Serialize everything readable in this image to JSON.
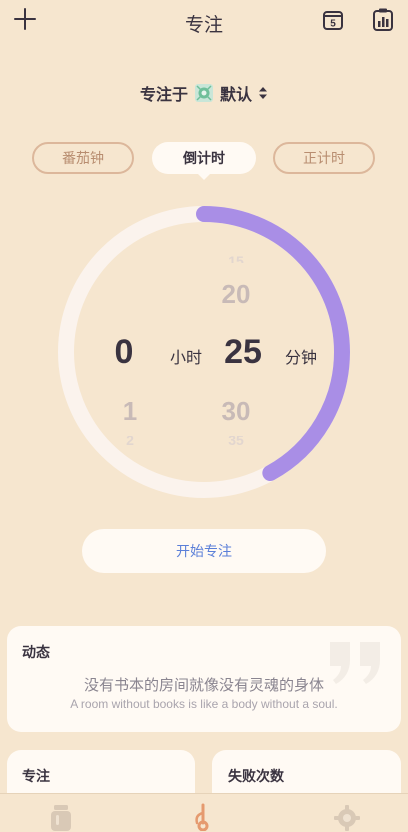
{
  "header": {
    "title": "专注",
    "calendar_day": "5"
  },
  "focus_target": {
    "prefix": "专注于",
    "name": "默认"
  },
  "modes": {
    "pomodoro": "番茄钟",
    "countdown": "倒计时",
    "countup": "正计时"
  },
  "timer": {
    "hours": "0",
    "hours_unit": "小时",
    "minutes": "25",
    "minutes_unit": "分钟",
    "hour_wheel_below": "1",
    "minute_wheel_above": "20",
    "minute_wheel_below": "30",
    "progress_fraction": 0.42
  },
  "start_button": "开始专注",
  "activity": {
    "title": "动态",
    "quote_zh": "没有书本的房间就像没有灵魂的身体",
    "quote_en": "A room without books is like a body without a soul."
  },
  "stats": {
    "focus_label": "专注",
    "fail_label": "失败次数"
  },
  "colors": {
    "background": "#f6e6cf",
    "progress": "#a98ee6",
    "track": "#fbf3ed",
    "accent_blue": "#5b7fd8",
    "tab_border": "#dcb79b"
  },
  "icons": [
    "plus-icon",
    "calendar-icon",
    "clipboard-chart-icon",
    "focus-target-icon",
    "sort-arrows-icon",
    "quote-icon",
    "jar-icon",
    "focus-nav-icon",
    "settings-gear-icon"
  ]
}
